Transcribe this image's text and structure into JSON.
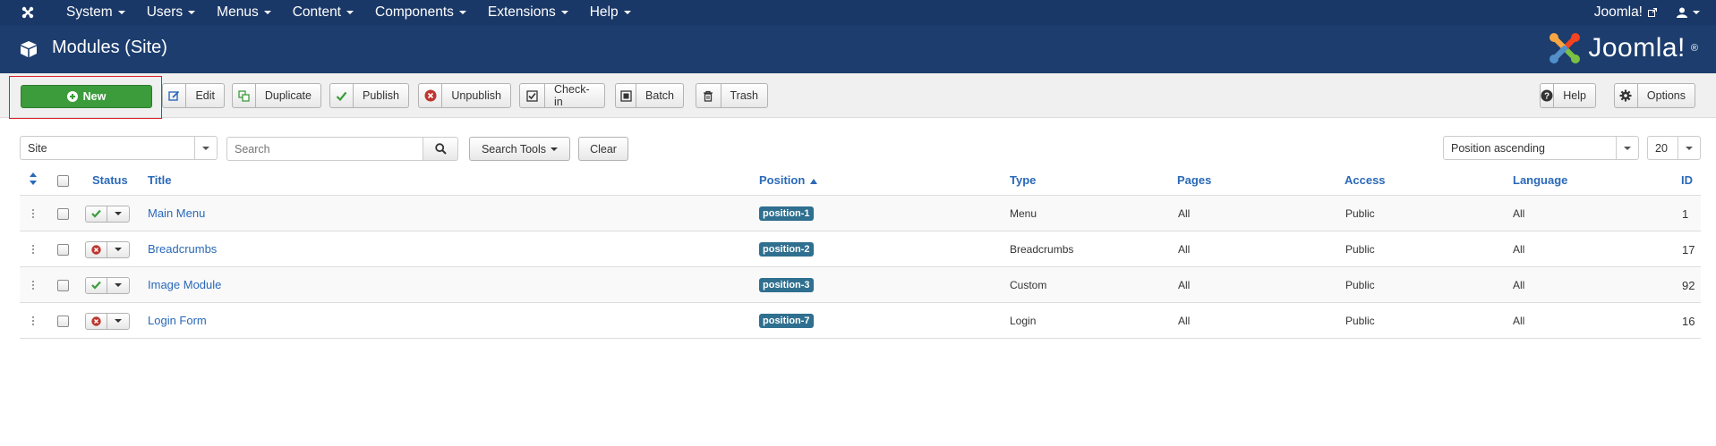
{
  "topnav": {
    "menus": [
      {
        "label": "System"
      },
      {
        "label": "Users"
      },
      {
        "label": "Menus"
      },
      {
        "label": "Content"
      },
      {
        "label": "Components"
      },
      {
        "label": "Extensions"
      },
      {
        "label": "Help"
      }
    ],
    "site_label": "Joomla!"
  },
  "header": {
    "title": "Modules (Site)",
    "brand": "Joomla!",
    "brand_mark": "®"
  },
  "toolbar": {
    "new_label": "New",
    "edit_label": "Edit",
    "duplicate_label": "Duplicate",
    "publish_label": "Publish",
    "unpublish_label": "Unpublish",
    "checkin_label": "Check-in",
    "batch_label": "Batch",
    "trash_label": "Trash",
    "help_label": "Help",
    "options_label": "Options"
  },
  "filters": {
    "client_value": "Site",
    "search_placeholder": "Search",
    "search_tools_label": "Search Tools",
    "clear_label": "Clear",
    "ordering_value": "Position ascending",
    "limit_value": "20"
  },
  "table": {
    "columns": {
      "status": "Status",
      "title": "Title",
      "position": "Position",
      "type": "Type",
      "pages": "Pages",
      "access": "Access",
      "language": "Language",
      "id": "ID"
    },
    "rows": [
      {
        "title": "Main Menu",
        "published": true,
        "position": "position-1",
        "type": "Menu",
        "pages": "All",
        "access": "Public",
        "language": "All",
        "id": "1"
      },
      {
        "title": "Breadcrumbs",
        "published": false,
        "position": "position-2",
        "type": "Breadcrumbs",
        "pages": "All",
        "access": "Public",
        "language": "All",
        "id": "17"
      },
      {
        "title": "Image Module",
        "published": true,
        "position": "position-3",
        "type": "Custom",
        "pages": "All",
        "access": "Public",
        "language": "All",
        "id": "92"
      },
      {
        "title": "Login Form",
        "published": false,
        "position": "position-7",
        "type": "Login",
        "pages": "All",
        "access": "Public",
        "language": "All",
        "id": "16"
      }
    ]
  },
  "colors": {
    "topnav_bg": "#1a3867",
    "header_bg": "#1c3d6e",
    "new_button": "#3c9c3c",
    "link": "#2a69b8",
    "badge": "#2f6f8f",
    "published": "#3c9c3c",
    "unpublished": "#bd362f"
  }
}
